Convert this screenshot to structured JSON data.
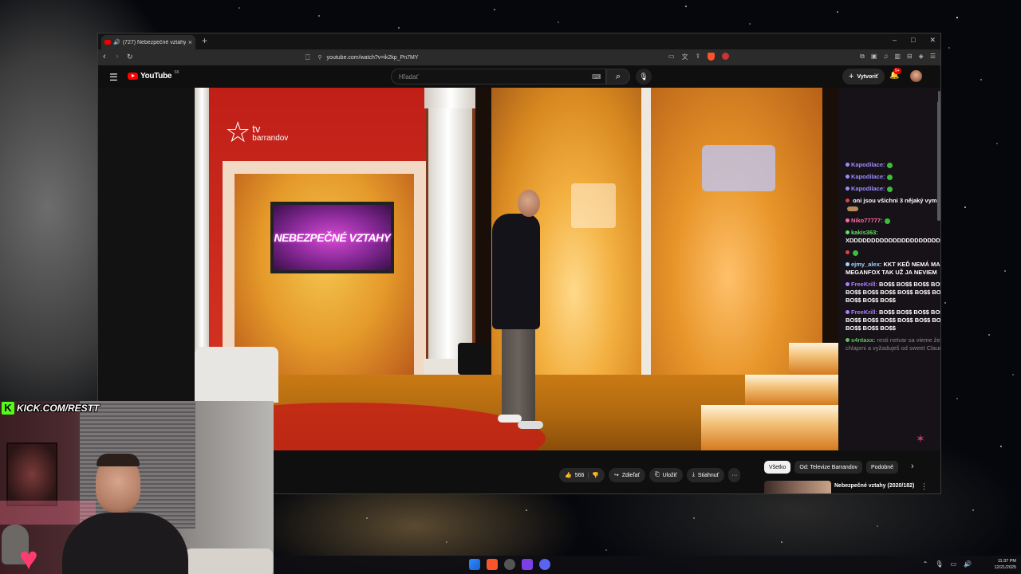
{
  "browser": {
    "tab_title": "(727) Nebezpečné vztahy (20",
    "url": "youtube.com/watch?v=ik2kp_Pn7MY",
    "window_controls": [
      "–",
      "□",
      "✕"
    ],
    "new_tab": "+"
  },
  "youtube": {
    "logo_text": "YouTube",
    "region": "SK",
    "search_placeholder": "Hľadať",
    "create_label": "Vytvoriť",
    "notifications_badge": "9+"
  },
  "video": {
    "watermark_tv": "tv",
    "watermark_brand": "barrandov",
    "screen_text": "NEBEZPEČNÉ VZTAHY"
  },
  "chat": {
    "lines": [
      {
        "user": "Kapodilace:",
        "text": "",
        "user_color": "#9b8cff",
        "emote": "green",
        "faded": false
      },
      {
        "user": "Kapodilace:",
        "text": "",
        "user_color": "#9b8cff",
        "emote": "green",
        "faded": false
      },
      {
        "user": "Kapodilace:",
        "text": "",
        "user_color": "#9b8cff",
        "emote": "green",
        "faded": false
      },
      {
        "user": "",
        "text": "oni jsou všichni 3 nějaký vymrdaný koukam",
        "user_color": "#e04040",
        "emote": "tan",
        "faded": false
      },
      {
        "user": "Niko77777:",
        "text": "",
        "user_color": "#ff6aa0",
        "emote": "green",
        "faded": false
      },
      {
        "user": "kakis363:",
        "text": "XDDDDDDDDDDDDDDDDDDDDDDDDDDDDDDDDDDDDDDDDDDDDDDDDDDDDDDD",
        "user_color": "#5fe05f",
        "emote": "",
        "faded": false
      },
      {
        "user": "",
        "text": "",
        "user_color": "#e04040",
        "emote": "green",
        "faded": false
      },
      {
        "user": "ejmy_alex:",
        "text": "KKT KEĎ NEMÁ MAMU MEGANFOX TAK UŽ JA NEVIEM",
        "user_color": "#9bd4ff",
        "emote": "",
        "faded": false
      },
      {
        "user": "FreeKrill:",
        "text": "BO$$ BO$$ BO$$ BO$$ BO$$ BO$$ BO$$ BO$$ BO$$ BO$$ BO$$ BO$$ BO$$ BO$$ BO$$",
        "user_color": "#b07cff",
        "emote": "",
        "faded": false
      },
      {
        "user": "FreeKrill:",
        "text": "BO$$ BO$$ BO$$ BO$$ BO$$ BO$$ BO$$ BO$$ BO$$ BO$$ BO$$ BO$$ BO$$ BO$$ BO$$",
        "user_color": "#b07cff",
        "emote": "",
        "faded": false
      },
      {
        "user": "s4ntaxx:",
        "text": "resti netvar sa vieme že suhlasiš s chlapmi a vyžaduješ od sweet Claudy to iste",
        "user_color": "#5fbf5f",
        "emote": "",
        "faded": true
      }
    ]
  },
  "actions": {
    "likes": "566",
    "share": "Zdieľať",
    "save": "Uložiť",
    "download": "Stiahnuť",
    "more": "···"
  },
  "chips": [
    "Všetko",
    "Od: Televize Barrandov",
    "Podobné"
  ],
  "recommendation": {
    "title": "Nebezpečné vztahy (2020/182)"
  },
  "overlay": {
    "kick_text": "KICK.COM/RESTT",
    "kick_letter": "K"
  },
  "taskbar": {
    "time": "11:37 PM",
    "date": "12/21/2025"
  }
}
